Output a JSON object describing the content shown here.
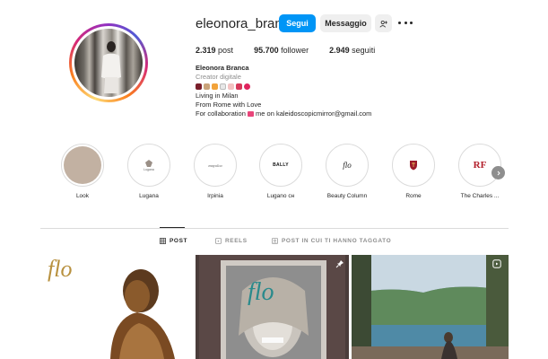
{
  "profile": {
    "username": "eleonora_branca",
    "follow_label": "Segui",
    "message_label": "Messaggio",
    "stats": {
      "posts_count": "2.319",
      "posts_label": "post",
      "followers_count": "95.700",
      "followers_label": "follower",
      "following_count": "2.949",
      "following_label": "seguiti"
    },
    "bio": {
      "name": "Eleonora Branca",
      "category": "Creator digitale",
      "line1": "Living in Milan",
      "line2": "From Rome with Love",
      "line3_prefix": "For collaboration ",
      "line3_suffix": " me on kaleidoscopicmirror@gmail.com"
    }
  },
  "highlights": [
    {
      "label": "Look"
    },
    {
      "label": "Lugana",
      "logo_text": "Lugana"
    },
    {
      "label": "Irpinia",
      "logo_text": "mayolca"
    },
    {
      "label": "Lugano ᴄʜ",
      "logo_text": "BALLY"
    },
    {
      "label": "Beauty Column",
      "logo_text": "flo"
    },
    {
      "label": "Rome"
    },
    {
      "label": "The Charles ...",
      "logo_text": "RF"
    }
  ],
  "tabs": {
    "posts": "POST",
    "reels": "REELS",
    "tagged": "POST IN CUI TI HANNO TAGGATO"
  },
  "posts": [
    {
      "caption_art": "flo"
    },
    {
      "caption_art": "flo"
    },
    {}
  ],
  "colors": {
    "follow_button": "#0095f6",
    "secondary_button": "#efefef",
    "text": "#262626",
    "muted": "#8e8e8e",
    "divider": "#dbdbdb"
  }
}
